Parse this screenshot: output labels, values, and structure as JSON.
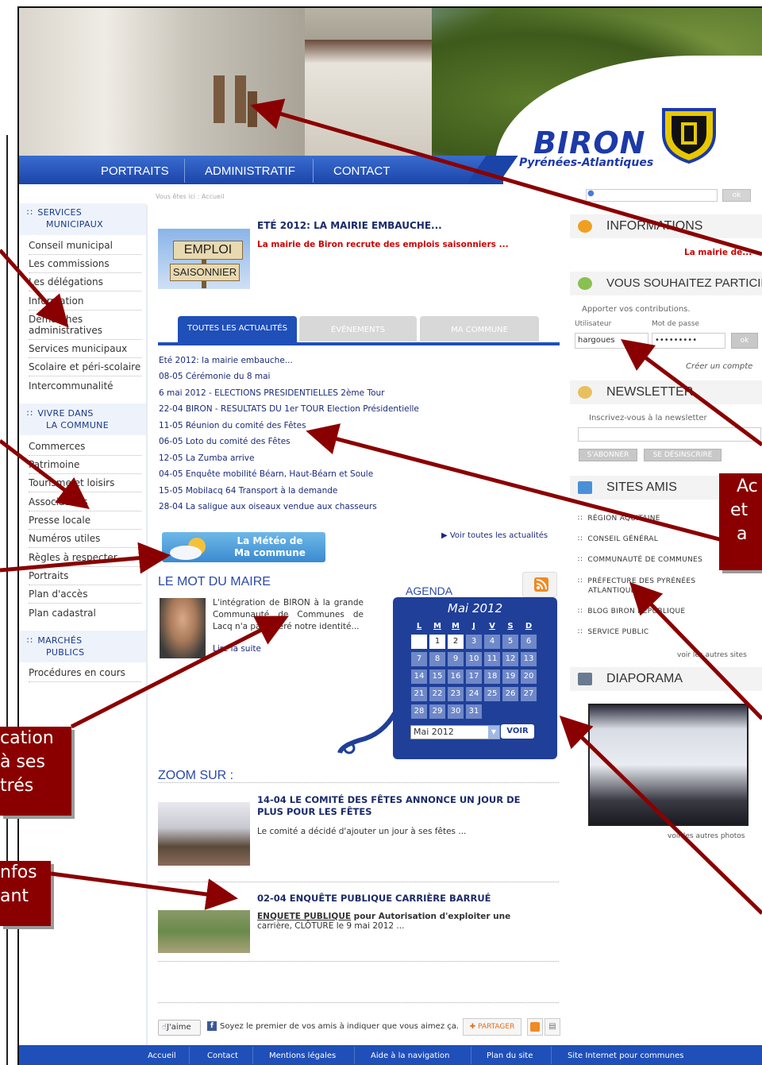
{
  "header": {
    "logo_title": "BIRON",
    "logo_subtitle": "Pyrénées-Atlantiques"
  },
  "nav": [
    "PORTRAITS",
    "ADMINISTRATIF",
    "CONTACT"
  ],
  "breadcrumb": "Vous êtes ici : Accueil",
  "search": {
    "button": "ok"
  },
  "sidebar": {
    "groups": [
      {
        "title_line1": "SERVICES",
        "title_line2": "MUNICIPAUX"
      },
      {
        "title_line1": "VIVRE DANS",
        "title_line2": "LA COMMUNE"
      },
      {
        "title_line1": "MARCHÉS",
        "title_line2": "PUBLICS"
      }
    ],
    "services": [
      "Conseil municipal",
      "Les commissions",
      "Les délégations",
      "Information",
      "Démarches",
      "administratives",
      "Services municipaux",
      "Scolaire et péri-scolaire",
      "Intercommunalité"
    ],
    "vivre": [
      "Commerces",
      "Patrimoine",
      "Tourisme et loisirs",
      "Associations",
      "Presse locale",
      "Numéros utiles",
      "Règles à respecter",
      "Portraits",
      "Plan d'accès",
      "Plan cadastral"
    ],
    "marches": [
      "Procédures en cours"
    ]
  },
  "feature": {
    "title": "ETÉ 2012: LA MAIRIE EMBAUCHE...",
    "subtitle": "La mairie de Biron recrute des emplois saisonniers ...",
    "sign1": "EMPLOI",
    "sign2": "SAISONNIER"
  },
  "tabs": [
    "TOUTES LES ACTUALITÉS",
    "ÉVÉNEMENTS",
    "MA COMMUNE"
  ],
  "news": [
    "Eté 2012: la mairie embauche...",
    "08-05 Cérémonie du 8 mai",
    "6 mai 2012 - ELECTIONS PRESIDENTIELLES 2ème Tour",
    "22-04 BIRON - RESULTATS DU 1er TOUR Election Présidentielle",
    "11-05 Réunion du comité des Fêtes",
    "06-05 Loto du comité des Fêtes",
    "12-05 La Zumba arrive",
    "04-05 Enquête mobilité Béarn, Haut-Béarn et Soule",
    "15-05 Mobilacq 64 Transport à la demande",
    "28-04 La saligue aux oiseaux vendue aux chasseurs"
  ],
  "meteo": {
    "line1": "La Météo de",
    "line2": "Ma commune"
  },
  "voir_toutes": "▶ Voir toutes les actualités",
  "mot_maire": {
    "title": "LE MOT DU MAIRE",
    "text": "L'intégration de BIRON à la grande Communauté de Communes de Lacq n'a pas altéré notre identité...",
    "more": "Lire la suite"
  },
  "agenda": {
    "title": "AGENDA",
    "month": "Mai 2012",
    "weekdays": [
      "L",
      "M",
      "M",
      "J",
      "V",
      "S",
      "D"
    ],
    "days": [
      "",
      "1",
      "2",
      "3",
      "4",
      "5",
      "6",
      "7",
      "8",
      "9",
      "10",
      "11",
      "12",
      "13",
      "14",
      "15",
      "16",
      "17",
      "18",
      "19",
      "20",
      "21",
      "22",
      "23",
      "24",
      "25",
      "26",
      "27",
      "28",
      "29",
      "30",
      "31"
    ],
    "select_value": "Mai 2012",
    "button": "VOIR"
  },
  "zoom": {
    "title": "ZOOM SUR :",
    "items": [
      {
        "title_line1": "14-04 LE COMITÉ DES FÊTES ANNONCE UN JOUR DE",
        "title_line2": "PLUS POUR LES FÊTES",
        "text": "Le comité a décidé d'ajouter un jour à ses fêtes ..."
      },
      {
        "title_line1": "02-04 ENQUÊTE PUBLIQUE CARRIÈRE BARRUÉ",
        "text_bold": "ENQUETE PUBLIQUE",
        "text_line1_rest": " pour Autorisation d'exploiter une",
        "text_line2": "carrière, CLÔTURE le 9 mai 2012 ..."
      }
    ]
  },
  "social": {
    "like": "J'aime",
    "fb_text": "Soyez le premier de vos amis à indiquer que vous aimez ça.",
    "share": "PARTAGER"
  },
  "right": {
    "informations": {
      "title": "INFORMATIONS",
      "text": "La mairie de..."
    },
    "participer": {
      "title": "VOUS SOUHAITEZ PARTICIPER",
      "intro": "Apporter vos contributions.",
      "user_label": "Utilisateur",
      "pass_label": "Mot de passe",
      "user_value": "hargoues",
      "pass_value": "•••••••••",
      "ok": "ok",
      "create": "Créer un compte"
    },
    "newsletter": {
      "title": "NEWSLETTER",
      "intro": "Inscrivez-vous à la newsletter",
      "subscribe": "S'ABONNER",
      "unsubscribe": "SE DÉSINSCRIRE"
    },
    "sites": {
      "title": "SITES AMIS",
      "items": [
        "RÉGION AQUITAINE",
        "CONSEIL GÉNÉRAL",
        "COMMUNAUTÉ DE COMMUNES",
        "PRÉFECTURE DES PYRÉNÉES",
        "ATLANTIQUES",
        "BLOG BIRON RÉPUBLIQUE",
        "SERVICE PUBLIC"
      ],
      "more": "voir les autres sites"
    },
    "diaporama": {
      "title": "DIAPORAMA",
      "more": "voir les autres photos"
    }
  },
  "footer": [
    "Accueil",
    "Contact",
    "Mentions légales",
    "Aide à la navigation",
    "Plan du site",
    "Site Internet pour communes"
  ],
  "callouts": {
    "right_1_line1": "Ac",
    "right_1_line2": "et a",
    "left_1_line1": "cation",
    "left_1_line2": "à ses",
    "left_1_line3": "trés",
    "left_2_line1": "nfos",
    "left_2_line2": "ant"
  },
  "colors": {
    "brand_blue": "#1f4fb8",
    "callout_red": "#8a0000",
    "alert_red": "#cc0000"
  }
}
